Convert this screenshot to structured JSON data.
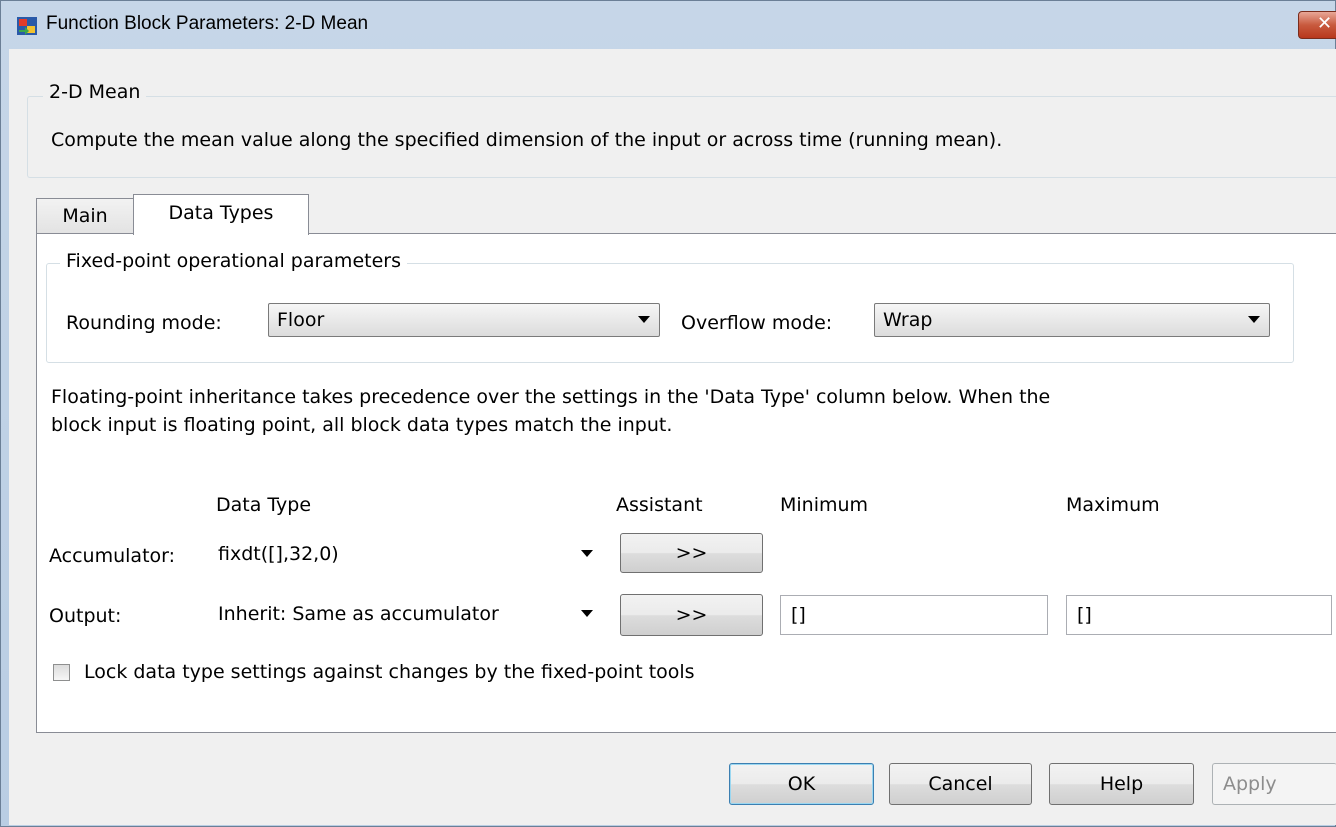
{
  "window": {
    "title": "Function Block Parameters: 2-D Mean",
    "close_glyph": "✕"
  },
  "description_group": {
    "legend": "2-D Mean",
    "text": "Compute the mean value along the specified dimension of the input or across time (running mean)."
  },
  "tabs": [
    {
      "label": "Main",
      "selected": false
    },
    {
      "label": "Data Types",
      "selected": true
    }
  ],
  "fixed_point": {
    "legend": "Fixed-point operational parameters",
    "rounding_label": "Rounding mode:",
    "rounding_value": "Floor",
    "overflow_label": "Overflow mode:",
    "overflow_value": "Wrap"
  },
  "note": {
    "line1": "Floating-point inheritance takes precedence over the settings in the 'Data Type' column below. When the",
    "line2": "block input is floating point, all block data types match the input."
  },
  "table": {
    "headers": {
      "data_type": "Data Type",
      "assistant": "Assistant",
      "minimum": "Minimum",
      "maximum": "Maximum"
    },
    "rows": [
      {
        "label": "Accumulator:",
        "data_type": "fixdt([],32,0)",
        "assistant": ">>"
      },
      {
        "label": "Output:",
        "data_type": "Inherit: Same as accumulator",
        "assistant": ">>",
        "minimum": "[]",
        "maximum": "[]"
      }
    ]
  },
  "lock_checkbox": {
    "label": "Lock data type settings against changes by the fixed-point tools",
    "checked": false
  },
  "buttons": {
    "ok": "OK",
    "cancel": "Cancel",
    "help": "Help",
    "apply": "Apply"
  },
  "colors": {
    "frame": "#c6d6e8",
    "client": "#f0f0f0",
    "close_button": "#c85a3e",
    "default_button_border": "#3c7fb1"
  }
}
